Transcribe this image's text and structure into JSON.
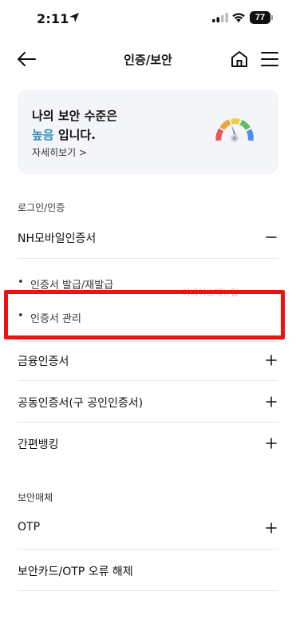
{
  "status_bar": {
    "time": "2:11",
    "battery": "77"
  },
  "header": {
    "title": "인증/보안"
  },
  "security_card": {
    "line1": "나의 보안 수준은",
    "level": "높음",
    "line2_suffix": " 입니다.",
    "detail_link": "자세히보기 >"
  },
  "sections": {
    "login_auth": {
      "label": "로그인/인증"
    },
    "nh_mobile": {
      "label": "NH모바일인증서",
      "icon": "minus-icon"
    },
    "sub_items": [
      {
        "bullet": "•",
        "label": "인증서 발급/재발급"
      },
      {
        "bullet": "•",
        "label": "인증서 관리"
      }
    ],
    "rows": [
      {
        "label": "금융인증서",
        "icon": "plus-icon"
      },
      {
        "label": "공동인증서(구 공인인증서)",
        "icon": "plus-icon"
      },
      {
        "label": "간편뱅킹",
        "icon": "plus-icon"
      }
    ],
    "security_media": {
      "label": "보안매체"
    },
    "media_rows": [
      {
        "label": "OTP",
        "icon": "plus-icon"
      },
      {
        "label": "보안카드/OTP 오류 해제"
      }
    ]
  },
  "watermark": "이베이스매뉴얼",
  "colors": {
    "highlight": "#ee1111",
    "level_text": "#2f8fb5",
    "card_bg": "#f3f5f8"
  }
}
